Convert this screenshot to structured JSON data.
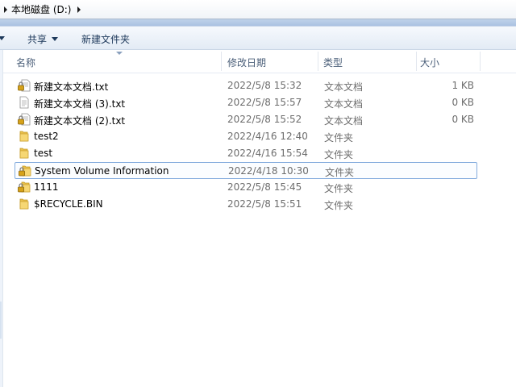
{
  "address": {
    "path": "本地磁盘 (D:)"
  },
  "toolbar": {
    "share_label": "共享",
    "new_folder_label": "新建文件夹"
  },
  "columns": {
    "name": "名称",
    "modified": "修改日期",
    "type": "类型",
    "size": "大小"
  },
  "files": [
    {
      "name": "新建文本文档.txt",
      "modified": "2022/5/8 15:32",
      "type": "文本文档",
      "size": "1 KB",
      "icon": "locked-text-file-icon"
    },
    {
      "name": "新建文本文档 (3).txt",
      "modified": "2022/5/8 15:57",
      "type": "文本文档",
      "size": "0 KB",
      "icon": "text-file-icon"
    },
    {
      "name": "新建文本文档 (2).txt",
      "modified": "2022/5/8 15:52",
      "type": "文本文档",
      "size": "0 KB",
      "icon": "locked-text-file-icon"
    },
    {
      "name": "test2",
      "modified": "2022/4/16 12:40",
      "type": "文件夹",
      "size": "",
      "icon": "folder-icon"
    },
    {
      "name": "test",
      "modified": "2022/4/16 15:54",
      "type": "文件夹",
      "size": "",
      "icon": "folder-icon"
    },
    {
      "name": "System Volume Information",
      "modified": "2022/4/18 10:30",
      "type": "文件夹",
      "size": "",
      "icon": "locked-folder-icon"
    },
    {
      "name": "1111",
      "modified": "2022/5/8 15:45",
      "type": "文件夹",
      "size": "",
      "icon": "locked-folder-icon"
    },
    {
      "name": "$RECYCLE.BIN",
      "modified": "2022/5/8 15:51",
      "type": "文件夹",
      "size": "",
      "icon": "folder-icon"
    }
  ]
}
